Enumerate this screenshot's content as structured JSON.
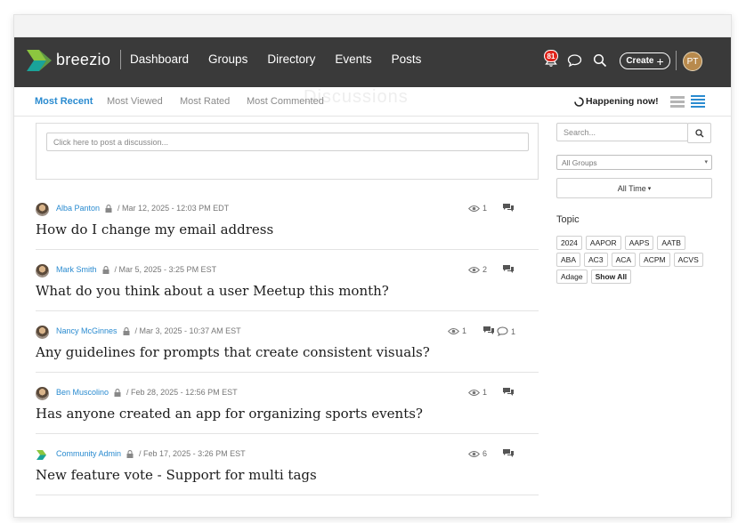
{
  "nav": {
    "brand": "breezio",
    "links": [
      "Dashboard",
      "Groups",
      "Directory",
      "Events",
      "Posts"
    ],
    "notification_count": "81",
    "create_label": "Create",
    "user_initials": "PT",
    "icons": [
      "bell-icon",
      "chat-bubble-icon",
      "search-icon",
      "plus-icon"
    ]
  },
  "tabs": {
    "items": [
      "Most Recent",
      "Most Viewed",
      "Most Rated",
      "Most Commented"
    ],
    "active": "Most Recent",
    "ghost_title": "Discussions",
    "happening_now": "Happening now!"
  },
  "post_box": {
    "placeholder": "Click here to post a discussion..."
  },
  "discussions": [
    {
      "author": "Alba Panton",
      "date": "/ Mar 12, 2025 - 12:03 PM EDT",
      "title": "How do I change my email address",
      "views": "1",
      "replies": ""
    },
    {
      "author": "Mark Smith",
      "date": "/ Mar 5, 2025 - 3:25 PM EST",
      "title": "What do you think about a user Meetup this month?",
      "views": "2",
      "replies": ""
    },
    {
      "author": "Nancy McGinnes",
      "date": "/ Mar 3, 2025 - 10:37 AM EST",
      "title": "Any guidelines for prompts that create consistent visuals?",
      "views": "1",
      "replies": "1"
    },
    {
      "author": "Ben Muscolino",
      "date": "/ Feb 28, 2025 - 12:56 PM EST",
      "title": "Has anyone created an app for organizing sports events?",
      "views": "1",
      "replies": ""
    },
    {
      "author": "Community Admin",
      "date": "/ Feb 17, 2025 - 3:26 PM EST",
      "title": "New feature vote - Support for multi tags",
      "views": "6",
      "replies": ""
    }
  ],
  "sidebar": {
    "search_placeholder": "Search...",
    "groups_select": "All Groups",
    "time_filter": "All Time",
    "topic_label": "Topic",
    "tags": [
      "2024",
      "AAPOR",
      "AAPS",
      "AATB",
      "ABA",
      "AC3",
      "ACA",
      "ACPM",
      "ACVS",
      "Adage"
    ],
    "show_all": "Show All"
  },
  "colors": {
    "nav_bg": "#3a3a3a",
    "accent": "#2a8bd0",
    "badge": "#e0241b"
  }
}
